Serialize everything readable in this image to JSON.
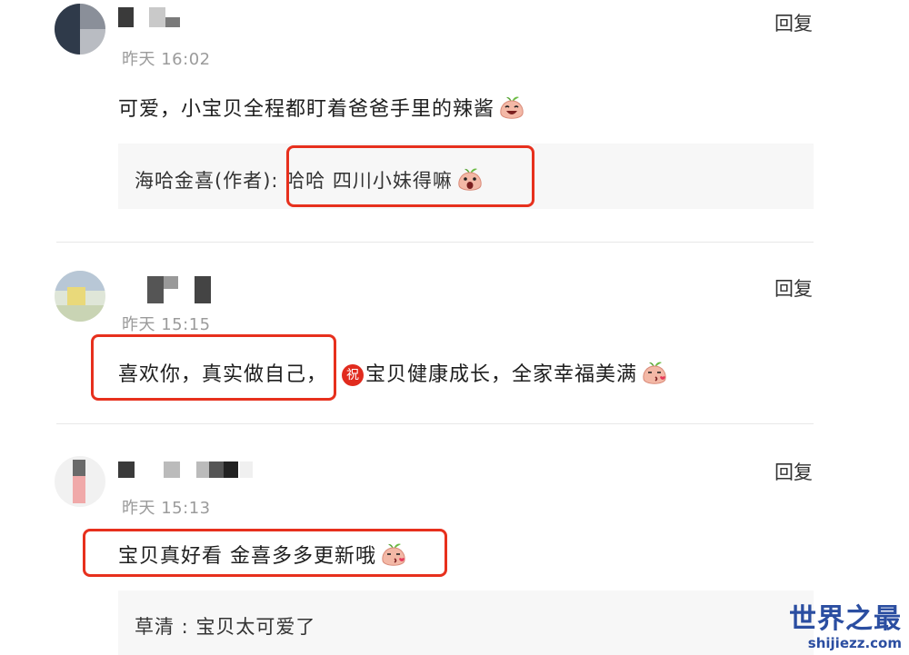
{
  "comments": [
    {
      "time": "昨天 16:02",
      "reply_label": "回复",
      "text": "可爱，小宝贝全程都盯着爸爸手里的辣酱",
      "emoji": "laughing-sprout-emoji",
      "sub_reply": {
        "author": "海哈金喜(作者)",
        "sep": ": ",
        "text": "哈哈 四川小妹得嘛",
        "emoji": "surprised-sprout-emoji"
      }
    },
    {
      "time": "昨天 15:15",
      "reply_label": "回复",
      "text_a": "喜欢你，真实做自己，",
      "zhu": "祝",
      "text_b": "宝贝健康成长，全家幸福美满",
      "emoji": "kiss-sprout-emoji"
    },
    {
      "time": "昨天 15:13",
      "reply_label": "回复",
      "text": "宝贝真好看 金喜多多更新哦",
      "emoji": "kiss-sprout-emoji",
      "sub_reply": {
        "author": "草清",
        "sep": " : ",
        "text": "宝贝太可爱了"
      }
    }
  ],
  "watermark": {
    "title": "世界之最",
    "url": "shijiezz.com"
  },
  "colors": {
    "highlight": "#e7301d",
    "watermark": "#2b4ea1"
  }
}
